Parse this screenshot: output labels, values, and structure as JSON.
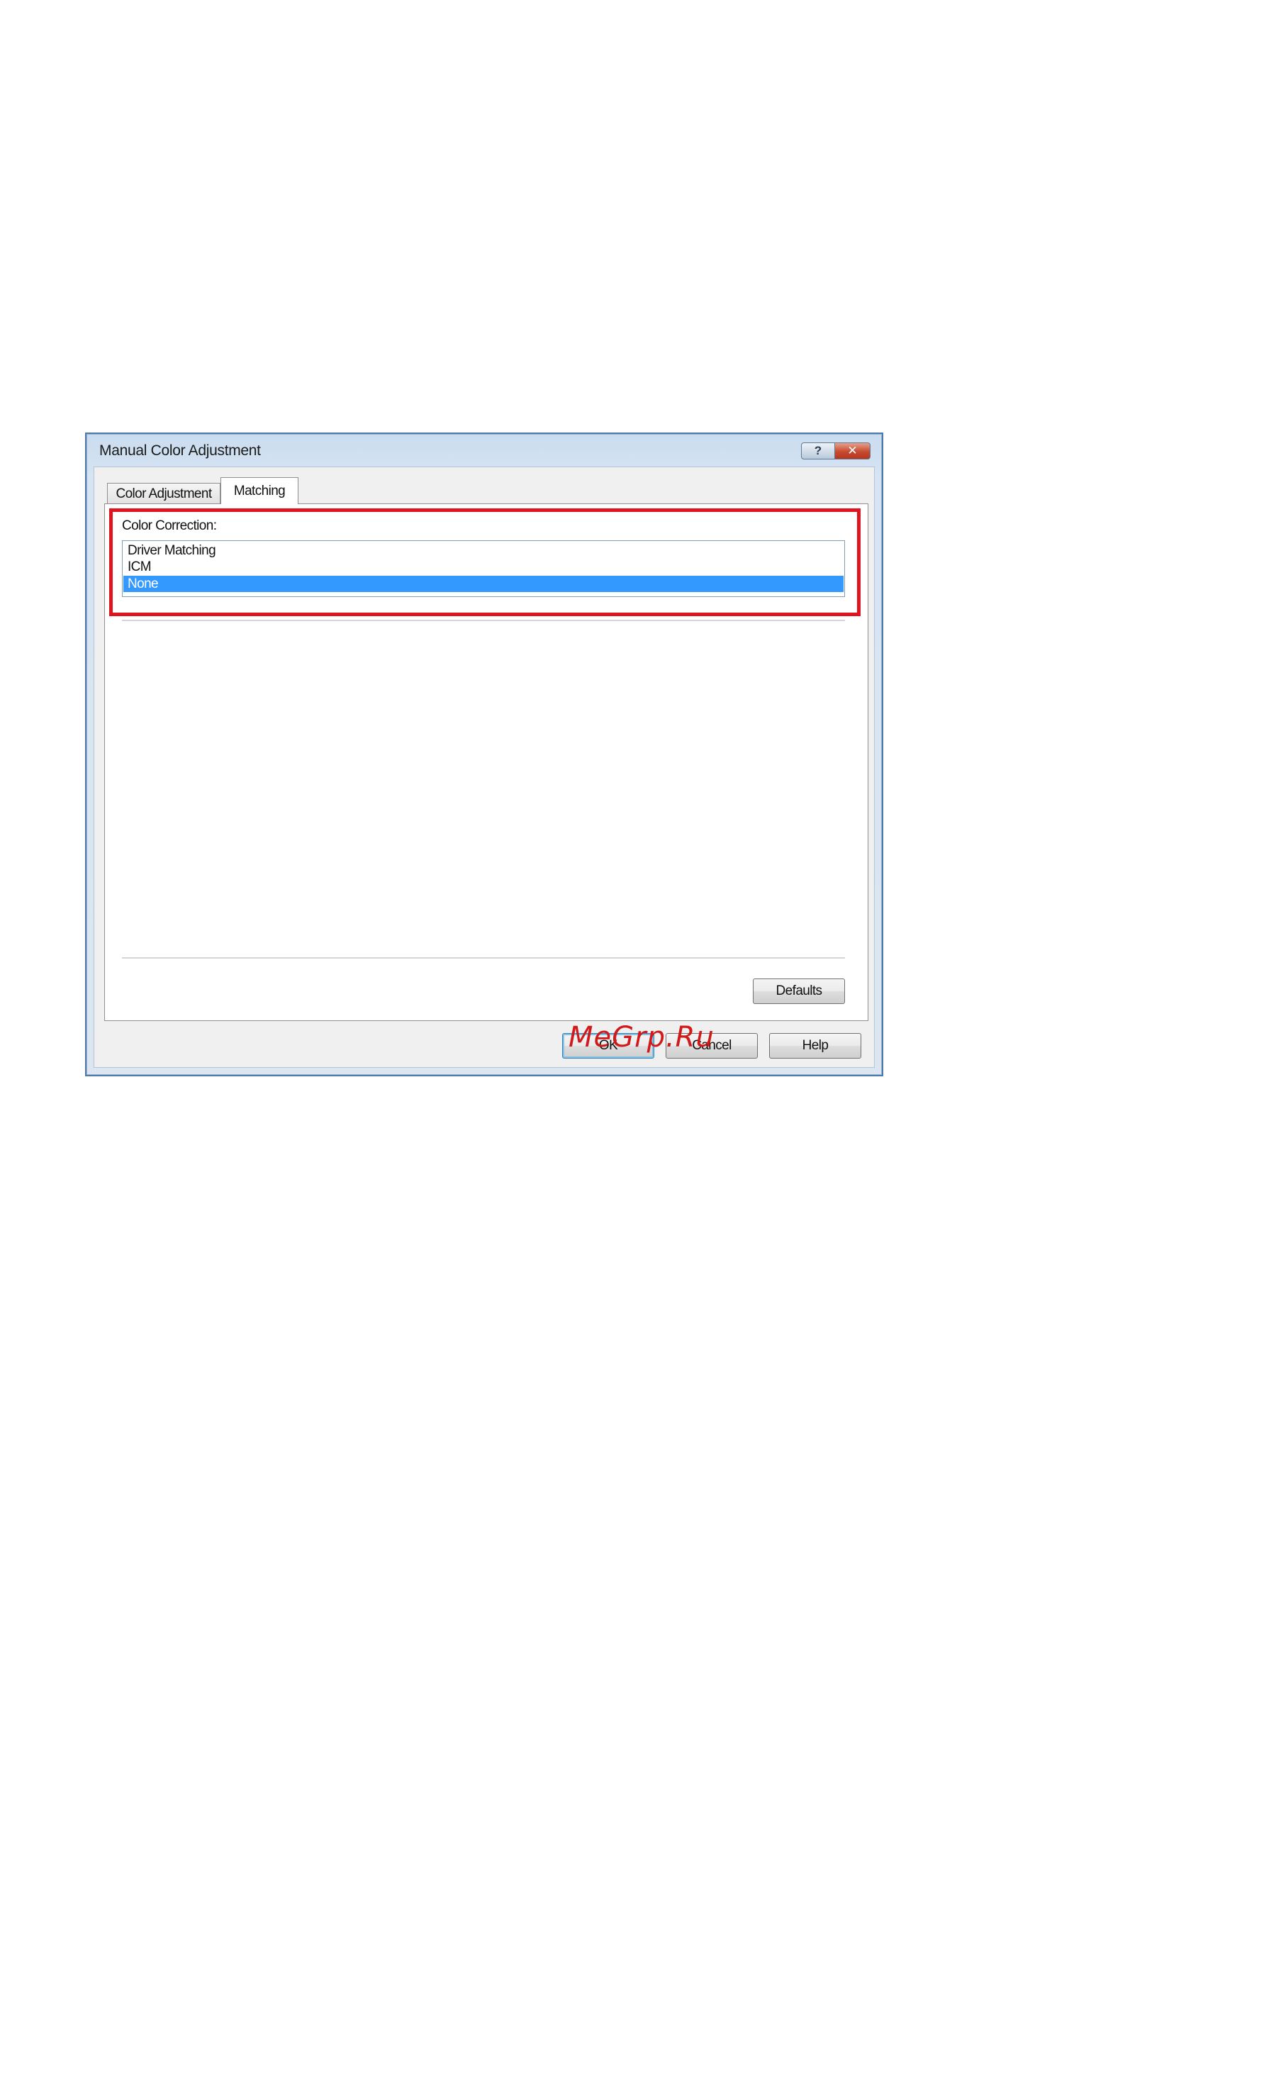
{
  "dialog": {
    "title": "Manual Color Adjustment",
    "help_button": "?",
    "close_button": "✕"
  },
  "tabs": [
    {
      "label": "Color Adjustment",
      "selected": false
    },
    {
      "label": "Matching",
      "selected": true
    }
  ],
  "color_correction": {
    "label": "Color Correction:",
    "options": [
      "Driver Matching",
      "ICM",
      "None"
    ],
    "selected": "None"
  },
  "buttons": {
    "defaults": "Defaults",
    "ok": "OK",
    "cancel": "Cancel",
    "help": "Help"
  },
  "watermark": "MeGrp.Ru",
  "colors": {
    "highlight": "#e0141f",
    "selection": "#3399ff",
    "watermark": "#d01a1a"
  }
}
